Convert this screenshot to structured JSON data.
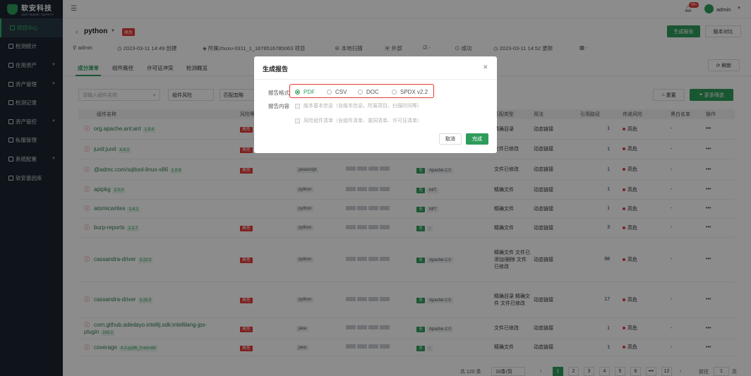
{
  "brand": {
    "name_cn": "软安科技",
    "name_en": "SOFTWARE SAFETY",
    "accent": "#2e9d5b",
    "danger": "#e53935"
  },
  "sidebar": {
    "items": [
      {
        "label": "项目中心",
        "active": true
      },
      {
        "label": "检测统计"
      },
      {
        "label": "在用资产"
      },
      {
        "label": "资产管理"
      },
      {
        "label": "检测记录"
      },
      {
        "label": "资产管控"
      },
      {
        "label": "私服管理"
      },
      {
        "label": "系统配置"
      },
      {
        "label": "软安基因库"
      }
    ]
  },
  "topbar": {
    "notif_badge": "99+",
    "user": "admin"
  },
  "project": {
    "title": "python",
    "risk_tag": "高危",
    "generate_button": "生成报告",
    "compare_button": "版本对比",
    "meta": {
      "owner": "admin",
      "created": "2023-03-11 14:49 创建",
      "belong": "所属zhuxu-0311_1_1678516785063 项目",
      "scan_type": "本地扫描",
      "source": "外部",
      "status": "成功",
      "updated": "2023-03-11 14:52 更新"
    }
  },
  "tabs": [
    "成分清单",
    "组件路径",
    "许可证冲突",
    "检测概览"
  ],
  "refresh_label": "刷新",
  "filters": {
    "search_placeholder": "请输入组件名称",
    "risk_select": "组件风险",
    "match_select": "匹配忽略",
    "reset": "重置",
    "more": "更多筛选"
  },
  "table": {
    "headers": {
      "name": "组件名称",
      "risk": "风险等级",
      "type": "匹配类型",
      "usage": "用法",
      "refs": "引用路径",
      "transitive": "传递风险",
      "blacklist": "黑白名单",
      "ops": "操作"
    },
    "rows": [
      {
        "name": "org.apache.ant:ant",
        "ver": "1.9.4",
        "risk": "高危",
        "lang": "",
        "lic_flag": "",
        "lic": "",
        "match": "精确目录",
        "usage": "动态链接",
        "refs": "1",
        "trisk": "高危",
        "bw": "-"
      },
      {
        "name": "junit:junit",
        "ver": "4.8.1",
        "risk": "高危",
        "lang": "",
        "lic_flag": "",
        "lic": "",
        "match": "文件已修改",
        "usage": "动态链接",
        "refs": "1",
        "trisk": "高危",
        "bw": "-"
      },
      {
        "name": "@admc.com/sqltool-linux-x86",
        "ver": "1.0.9",
        "risk": "高危",
        "lang": "javascript",
        "lic_flag": "无",
        "lic": "Apache-2.0",
        "match": "文件已修改",
        "usage": "动态链接",
        "refs": "1",
        "trisk": "高危",
        "bw": "-"
      },
      {
        "name": "apipkg",
        "ver": "2.0.0",
        "risk": "",
        "lang": "python",
        "lic_flag": "无",
        "lic": "MIT",
        "match": "精确文件",
        "usage": "动态链接",
        "refs": "1",
        "trisk": "高危",
        "bw": "-"
      },
      {
        "name": "atomicwrites",
        "ver": "1.4.1",
        "risk": "",
        "lang": "python",
        "lic_flag": "无",
        "lic": "MIT",
        "match": "精确文件",
        "usage": "动态链接",
        "refs": "1",
        "trisk": "高危",
        "bw": "-"
      },
      {
        "name": "burp-reports",
        "ver": "1.2.7",
        "risk": "高危",
        "lang": "python",
        "lic_flag": "无",
        "lic": "-",
        "match": "精确文件",
        "usage": "动态链接",
        "refs": "3",
        "trisk": "高危",
        "bw": "-"
      },
      {
        "name": "cassandra-driver",
        "ver": "3.22.0",
        "risk": "高危",
        "lang": "python",
        "lic_flag": "无",
        "lic": "Apache-2.0",
        "match": "精确文件 文件已添加/删除 文件已修改",
        "usage": "动态链接",
        "refs": "98",
        "trisk": "高危",
        "bw": "-"
      },
      {
        "name": "cassandra-driver",
        "ver": "3.25.0",
        "risk": "高危",
        "lang": "python",
        "lic_flag": "无",
        "lic": "Apache-2.0",
        "match": "精确目录 精确文件 文件已修改",
        "usage": "动态链接",
        "refs": "17",
        "trisk": "高危",
        "bw": "-"
      },
      {
        "name": "com.github.adedayo.intellij.sdk:intellilang-jps-plugin",
        "ver": "142.1",
        "risk": "高危",
        "lang": "java",
        "lic_flag": "无",
        "lic": "Apache-2.0",
        "match": "文件已修改",
        "usage": "动态链接",
        "refs": "1",
        "trisk": "高危",
        "bw": "-"
      },
      {
        "name": "coverage",
        "ver": "4.2-py36_0-win-64",
        "risk": "高危",
        "lang": "java",
        "lic_flag": "无",
        "lic": "-",
        "match": "精确文件",
        "usage": "动态链接",
        "refs": "1",
        "trisk": "高危",
        "bw": "-"
      }
    ]
  },
  "pager": {
    "total": "共 120 条",
    "per_page": "10条/页",
    "pages": [
      "1",
      "2",
      "3",
      "4",
      "5",
      "6",
      "•••",
      "12"
    ],
    "goto": "前往",
    "goto_value": "1",
    "page_suffix": "页"
  },
  "modal": {
    "title": "生成报告",
    "format_label": "报告格式",
    "formats": [
      {
        "label": "PDF",
        "selected": true
      },
      {
        "label": "CSV"
      },
      {
        "label": "DOC"
      },
      {
        "label": "SPDX v2.2"
      }
    ],
    "content_label": "报告内容",
    "content_items": [
      "版本基本信息（含版本信息、所属项目、扫描时间等）",
      "风险组件清单（含组件清单、漏洞清单、许可证清单）"
    ],
    "cancel": "取消",
    "confirm": "完成"
  }
}
